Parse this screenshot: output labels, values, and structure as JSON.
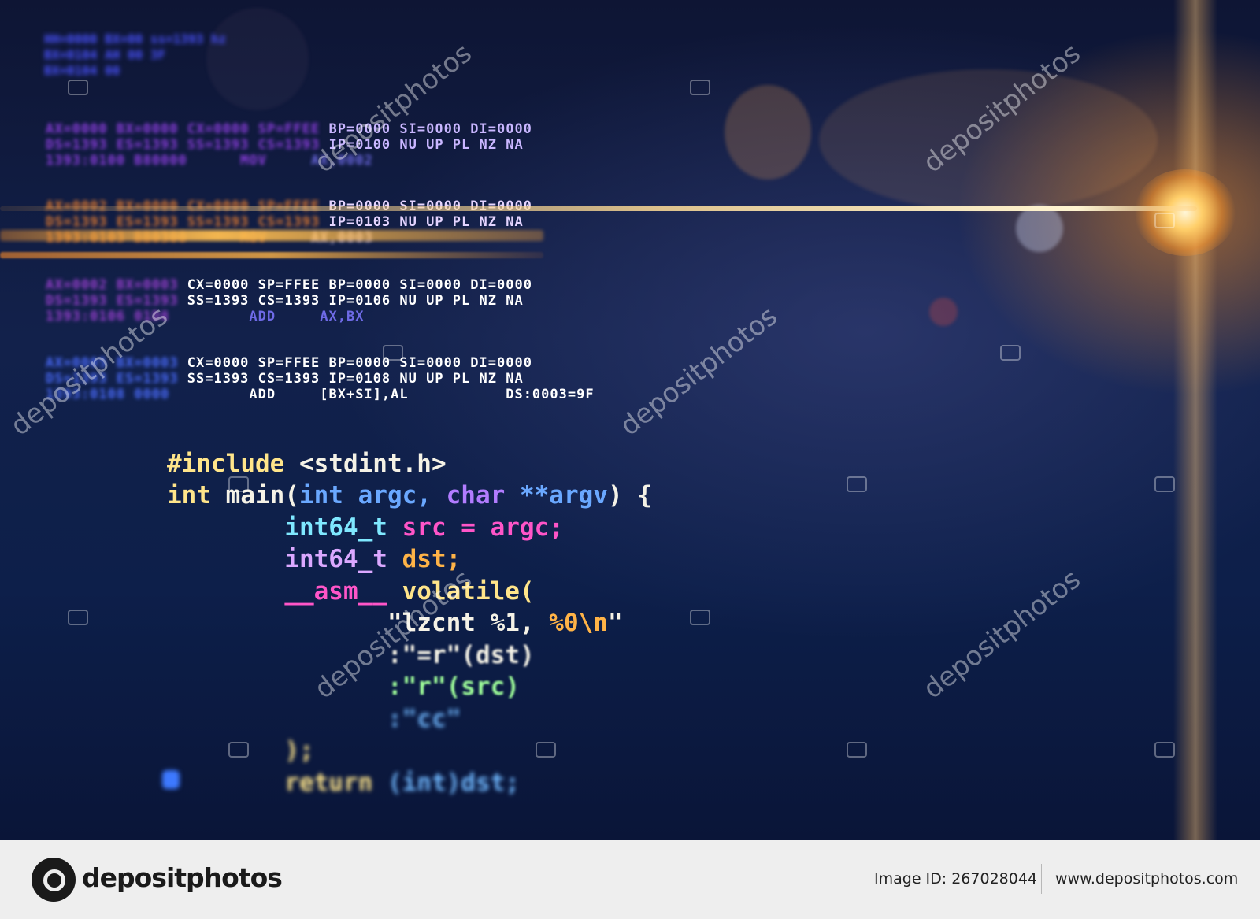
{
  "top_block": [
    "HH=0000 BX=00 ss=1393 hz",
    "BX=0104 AH 00 3F",
    "BX=0104 00"
  ],
  "dump_blocks": [
    {
      "rows": [
        {
          "pre": "AX=0000 BX=0000 CX=0000 SP=FFEE",
          "post": " BP=0000 SI=0000 DI=0000"
        },
        {
          "pre": "DS=1393 ES=1393 SS=1393 CS=1393",
          "post": " IP=0100 NU UP PL NZ NA"
        },
        {
          "pre": "1393:0100 B80000      MOV",
          "post": "     AX,0002"
        }
      ]
    },
    {
      "rows": [
        {
          "pre": "AX=0002 BX=0000 CX=0000 SP=FFEE",
          "post": " BP=0000 SI=0000 DI=0000"
        },
        {
          "pre": "DS=1393 ES=1393 SS=1393 CS=1393",
          "post": " IP=0103 NU UP PL NZ NA"
        },
        {
          "pre": "1393:0103 BB0300      MOV",
          "post": "     AX,0003"
        }
      ]
    },
    {
      "rows": [
        {
          "pre": "AX=0002 BX=0003",
          "post": " CX=0000 SP=FFEE BP=0000 SI=0000 DI=0000"
        },
        {
          "pre": "DS=1393 ES=1393",
          "post": " SS=1393 CS=1393 IP=0106 NU UP PL NZ NA"
        },
        {
          "pre": "1393:0106 01D8",
          "post": "         ADD     AX,BX"
        }
      ]
    },
    {
      "rows": [
        {
          "pre": "AX=0005 BX=0003",
          "post": " CX=0000 SP=FFEE BP=0000 SI=0000 DI=0000"
        },
        {
          "pre": "DS=1393 ES=1393",
          "post": " SS=1393 CS=1393 IP=0108 NU UP PL NZ NA"
        },
        {
          "pre": "1393:0108 0000",
          "post": "         ADD     [BX+SI],AL           DS:0003=9F"
        }
      ]
    }
  ],
  "code": {
    "line1": {
      "a": "#include",
      "b": " <stdint.h>"
    },
    "line2": {
      "a": "int",
      "b": " main(",
      "c": "int",
      "d": " argc, ",
      "e": "char",
      "f": " **argv",
      "g": ") {"
    },
    "line3": {
      "indent": "        ",
      "a": "int64_t",
      "b": " src = argc;"
    },
    "line4": {
      "indent": "        ",
      "a": "int64_t",
      "b": " dst;"
    },
    "line5": {
      "indent": "        ",
      "a": "__asm__",
      "b": " volatile("
    },
    "line6": {
      "indent": "               ",
      "a": "\"lzcnt %1, ",
      "b": "%0\\n",
      "c": "\""
    },
    "line7": {
      "indent": "               ",
      "a": ":\"=r\"(dst)"
    },
    "line8": {
      "indent": "               ",
      "a": ":\"r\"(src)"
    },
    "line9": {
      "indent": "               ",
      "a": ":\"cc\""
    },
    "line10": {
      "indent": "        ",
      "a": ");"
    },
    "line11": {
      "indent": "        ",
      "a": "return",
      "b": " (int)dst;"
    }
  },
  "watermark": "depositphotos",
  "footer": {
    "logo": "depositphotos",
    "image_id": "Image ID: 267028044",
    "site": "www.depositphotos.com"
  }
}
